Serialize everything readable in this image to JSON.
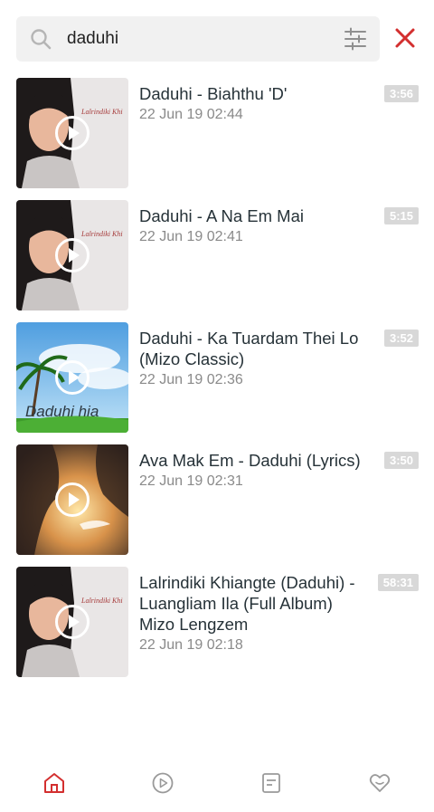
{
  "search": {
    "value": "daduhi"
  },
  "colors": {
    "accent": "#d32f2f",
    "icon_gray": "#9a9a9a"
  },
  "results": [
    {
      "title": "Daduhi - Biahthu 'D'",
      "date": "22 Jun 19 02:44",
      "duration": "3:56"
    },
    {
      "title": "Daduhi - A Na Em Mai",
      "date": "22 Jun 19 02:41",
      "duration": "5:15"
    },
    {
      "title": "Daduhi - Ka Tuardam Thei Lo (Mizo Classic)",
      "date": "22 Jun 19 02:36",
      "duration": "3:52"
    },
    {
      "title": "Ava Mak Em - Daduhi (Lyrics)",
      "date": "22 Jun 19 02:31",
      "duration": "3:50"
    },
    {
      "title": "Lalrindiki Khiangte (Daduhi) - Luangliam Ila (Full Album) Mizo Lengzem",
      "date": "22 Jun 19 02:18",
      "duration": "58:31"
    }
  ],
  "thumbnails": {
    "portrait_caption": "Lalrindiki Khi",
    "sky_caption": "Daduhi hia"
  },
  "nav": {
    "active": "home",
    "icons": [
      "home-icon",
      "play-circle-icon",
      "playlist-icon",
      "heart-icon"
    ]
  }
}
